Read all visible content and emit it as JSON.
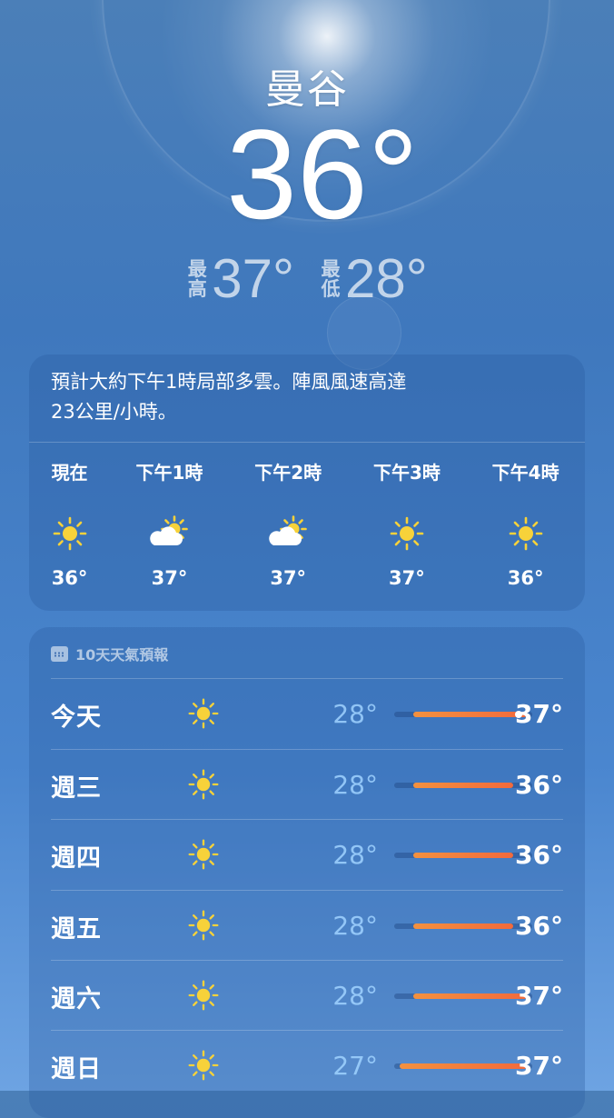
{
  "location": {
    "city": "曼谷"
  },
  "current": {
    "temperature": "36°",
    "high_label": "最高",
    "high": "37°",
    "low_label": "最低",
    "low": "28°"
  },
  "hourly": {
    "summary_line1": "預計大約下午1時局部多雲。陣風風速高達",
    "summary_line2": "23公里/小時。",
    "items": [
      {
        "time": "現在",
        "icon": "sun-icon",
        "temp": "36°"
      },
      {
        "time": "下午1時",
        "icon": "partly-cloudy-icon",
        "temp": "37°"
      },
      {
        "time": "下午2時",
        "icon": "partly-cloudy-icon",
        "temp": "37°"
      },
      {
        "time": "下午3時",
        "icon": "sun-icon",
        "temp": "37°"
      },
      {
        "time": "下午4時",
        "icon": "sun-icon",
        "temp": "36°"
      }
    ]
  },
  "forecast": {
    "title": "10天天氣預報",
    "range_min": 27,
    "range_max": 37,
    "days": [
      {
        "day": "今天",
        "icon": "sun-icon",
        "low": "28°",
        "high": "37°",
        "low_val": 28,
        "high_val": 37,
        "current_val": 36
      },
      {
        "day": "週三",
        "icon": "sun-icon",
        "low": "28°",
        "high": "36°",
        "low_val": 28,
        "high_val": 36
      },
      {
        "day": "週四",
        "icon": "sun-icon",
        "low": "28°",
        "high": "36°",
        "low_val": 28,
        "high_val": 36
      },
      {
        "day": "週五",
        "icon": "sun-icon",
        "low": "28°",
        "high": "36°",
        "low_val": 28,
        "high_val": 36
      },
      {
        "day": "週六",
        "icon": "sun-icon",
        "low": "28°",
        "high": "37°",
        "low_val": 28,
        "high_val": 37
      },
      {
        "day": "週日",
        "icon": "sun-icon",
        "low": "27°",
        "high": "37°",
        "low_val": 27,
        "high_val": 37
      }
    ]
  },
  "colors": {
    "sun": "#f7d23a",
    "bar_start": "#f3913f",
    "bar_end": "#f26a3c"
  }
}
